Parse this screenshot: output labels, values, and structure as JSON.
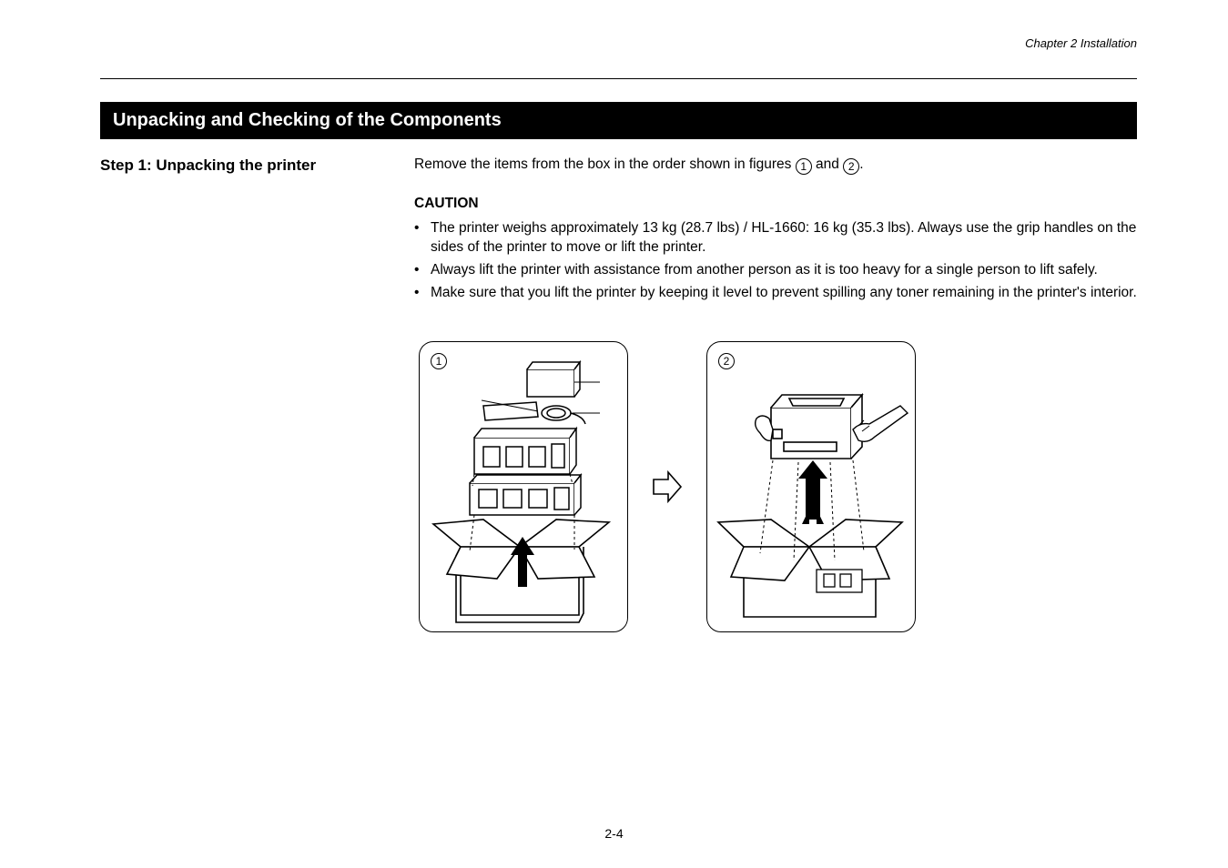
{
  "chapter_header": "Chapter 2 Installation",
  "section_title": "Unpacking and Checking of the Components",
  "step": {
    "label": "Step 1: Unpacking the printer",
    "para1_pre": "Remove the items from the box in the order shown in figures ",
    "para1_mid": " and ",
    "para1_post": "."
  },
  "caution": {
    "heading": "CAUTION",
    "items": [
      "The printer weighs approximately 13 kg (28.7 lbs) / HL-1660: 16 kg (35.3 lbs). Always use the grip handles on the sides of the printer to move or lift the printer.",
      "Always lift the printer with assistance from another person as it is too heavy for a single person to lift safely.",
      "Make sure that you lift the printer by keeping it level to prevent spilling any toner remaining in the printer's interior."
    ]
  },
  "figures": {
    "num1": "1",
    "num2": "2"
  },
  "page_number": "2-4"
}
